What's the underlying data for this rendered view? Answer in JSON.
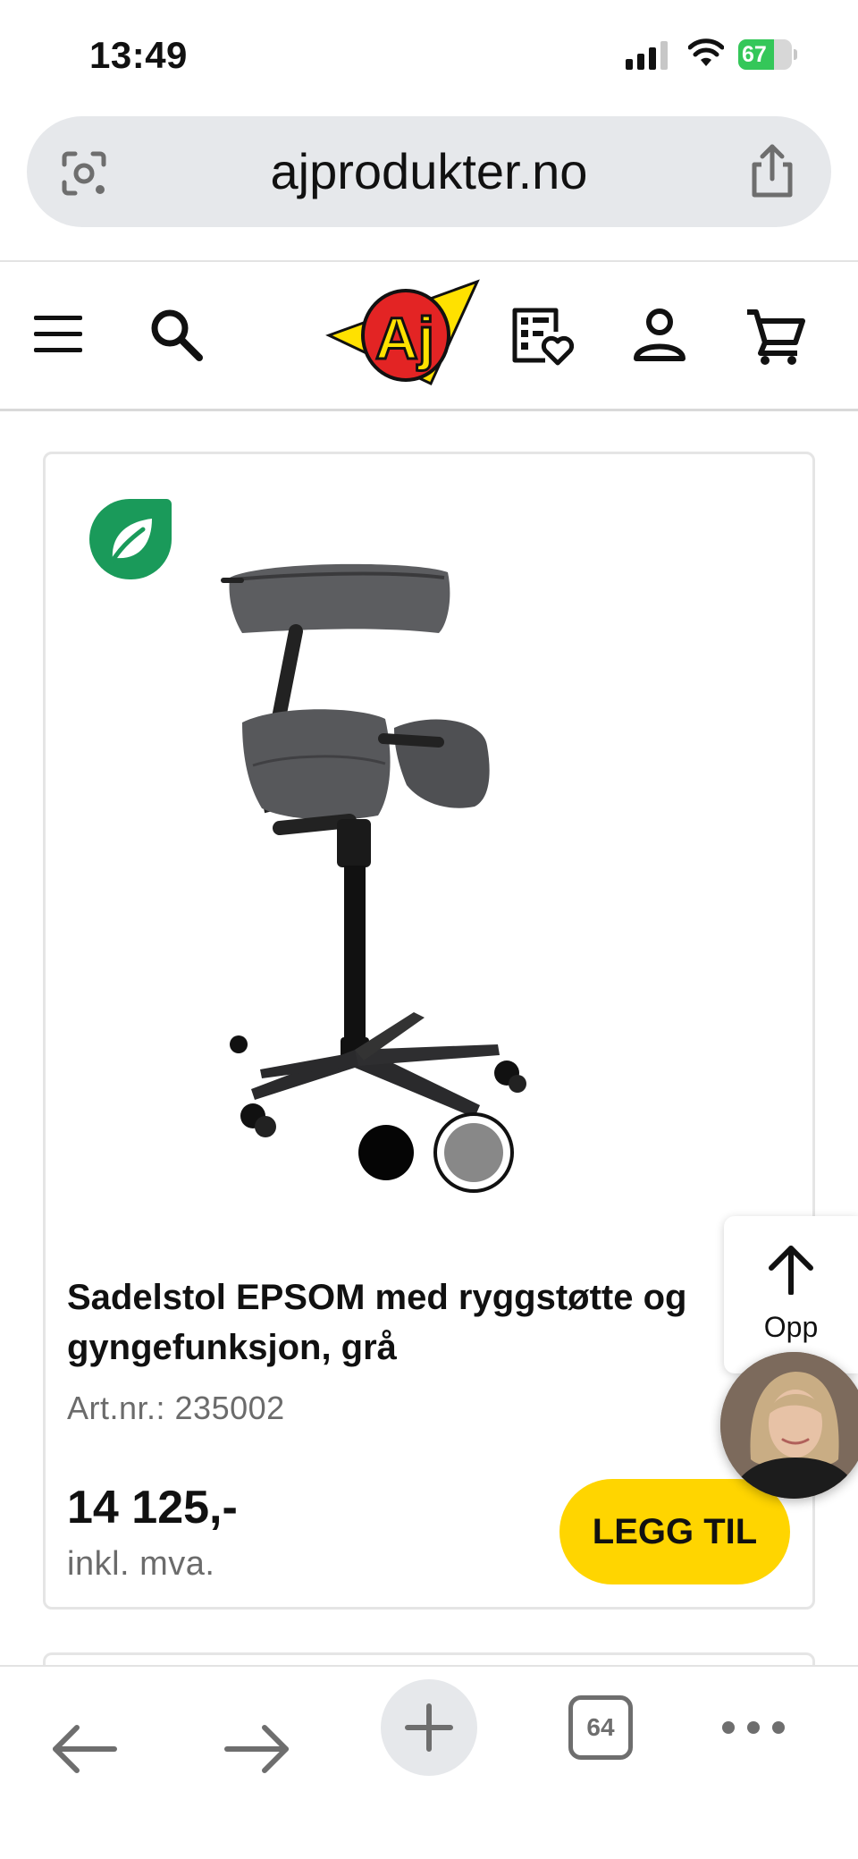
{
  "status_bar": {
    "time": "13:49",
    "battery_level": 67,
    "battery_label": "67",
    "icons": [
      "cellular-signal-icon",
      "wifi-icon",
      "battery-charging-icon"
    ]
  },
  "browser": {
    "url": "ajprodukter.no",
    "icons": [
      "lens-icon",
      "share-icon"
    ]
  },
  "site_header": {
    "logo_text": "Aj",
    "icons": [
      "menu-icon",
      "search-icon",
      "wishlist-icon",
      "account-icon",
      "cart-icon"
    ]
  },
  "product": {
    "title": "Sadelstol EPSOM med ryggstøtte og gyngefunksjon, grå",
    "art_nr": "Art.nr.: 235002",
    "price": "14 125,-",
    "price_note": "inkl. mva.",
    "add_button_label": "LEGG TIL",
    "eco_badge_icon": "leaf-icon",
    "swatches": [
      {
        "color": "#050505",
        "selected": false
      },
      {
        "color": "#888888",
        "selected": true
      }
    ]
  },
  "floating": {
    "to_top_label": "Opp",
    "chat_avatar": "support-agent-avatar"
  },
  "toolbar": {
    "tab_count": "64",
    "icons": [
      "back-arrow-icon",
      "forward-arrow-icon",
      "new-tab-plus-icon",
      "tabs-icon",
      "more-dots-icon"
    ]
  },
  "colors": {
    "accent_yellow": "#ffd500",
    "eco_green": "#1a9a5a",
    "battery_green": "#34c759"
  }
}
